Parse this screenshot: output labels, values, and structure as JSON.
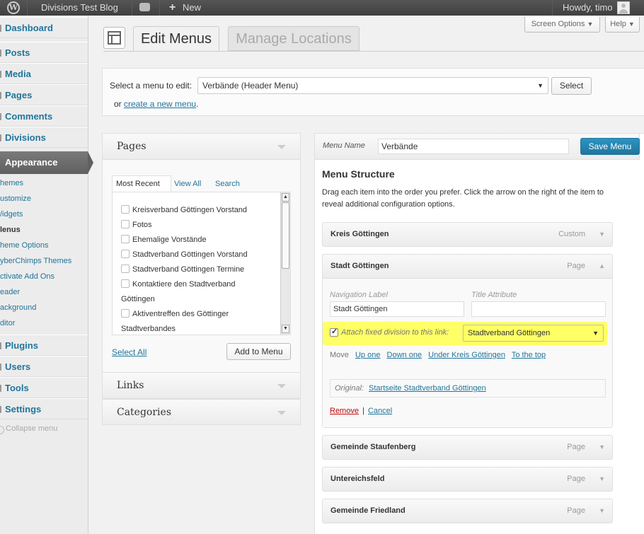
{
  "adminbar": {
    "site_name": "Divisions Test Blog",
    "new_label": "New",
    "howdy": "Howdy, timo",
    "icons": [
      "wordpress-logo-icon",
      "comment-bubble-icon",
      "plus-icon",
      "avatar-icon"
    ]
  },
  "sidebar": {
    "items": [
      {
        "label": "Dashboard"
      },
      {
        "label": "Posts"
      },
      {
        "label": "Media"
      },
      {
        "label": "Pages"
      },
      {
        "label": "Comments"
      },
      {
        "label": "Divisions"
      }
    ],
    "current": "Appearance",
    "submenu": [
      "hemes",
      "ustomize",
      "/idgets",
      "lenus",
      "heme Options",
      "yberChimps Themes",
      "ctivate Add Ons",
      "eader",
      "ackground",
      "ditor"
    ],
    "submenu_current_index": 3,
    "items_after": [
      {
        "label": "Plugins"
      },
      {
        "label": "Users"
      },
      {
        "label": "Tools"
      },
      {
        "label": "Settings"
      }
    ],
    "collapse": "Collapse menu"
  },
  "header": {
    "screen_options": "Screen Options",
    "help": "Help",
    "tabs": [
      {
        "label": "Edit Menus",
        "active": true
      },
      {
        "label": "Manage Locations",
        "active": false
      }
    ]
  },
  "manage": {
    "select_label": "Select a menu to edit:",
    "selected_menu": "Verbände (Header Menu)",
    "select_button": "Select",
    "or_text": "or",
    "create_link": "create a new menu",
    "period": "."
  },
  "pages_box": {
    "title": "Pages",
    "tabs": [
      "Most Recent",
      "View All",
      "Search"
    ],
    "items": [
      [
        "Kreisverband Göttingen Vorstand"
      ],
      [
        "Fotos"
      ],
      [
        "Ehemalige Vorstände"
      ],
      [
        "Stadtverband Göttingen Vorstand"
      ],
      [
        "Stadtverband Göttingen Termine"
      ],
      [
        "Kontaktiere den Stadtverband",
        "Göttingen"
      ],
      [
        "Aktiventreffen des Göttinger",
        "Stadtverbandes"
      ]
    ],
    "select_all": "Select All",
    "add_button": "Add to Menu"
  },
  "links_box": {
    "title": "Links"
  },
  "categories_box": {
    "title": "Categories"
  },
  "menu_editor": {
    "name_label": "Menu Name",
    "name_value": "Verbände",
    "save_button": "Save Menu",
    "structure_title": "Menu Structure",
    "structure_desc_1": "Drag each item into the order you prefer. Click the arrow on the right of the item to",
    "structure_desc_2": "reveal additional configuration options.",
    "items": [
      {
        "title": "Kreis Göttingen",
        "type": "Custom"
      },
      {
        "title": "Stadt Göttingen",
        "type": "Page"
      },
      {
        "title": "Gemeinde Staufenberg",
        "type": "Page"
      },
      {
        "title": "Untereichsfeld",
        "type": "Page"
      },
      {
        "title": "Gemeinde Friedland",
        "type": "Page"
      }
    ],
    "expanded": {
      "nav_label_label": "Navigation Label",
      "nav_label_value": "Stadt Göttingen",
      "title_attr_label": "Title Attribute",
      "title_attr_value": "",
      "attach_label": "Attach fixed division to this link:",
      "attach_checked": true,
      "division_value": "Stadtverband Göttingen",
      "highlight_color": "#ffff66",
      "move_label": "Move",
      "move_links": [
        "Up one",
        "Down one",
        "Under Kreis Göttingen",
        "To the top"
      ],
      "original_label": "Original:",
      "original_link": "Startseite Stadtverband Göttingen",
      "remove": "Remove",
      "sep": "|",
      "cancel": "Cancel"
    }
  },
  "colors": {
    "link": "#21759b",
    "remove": "#bc0b0b",
    "admin_bar": "#464646"
  }
}
